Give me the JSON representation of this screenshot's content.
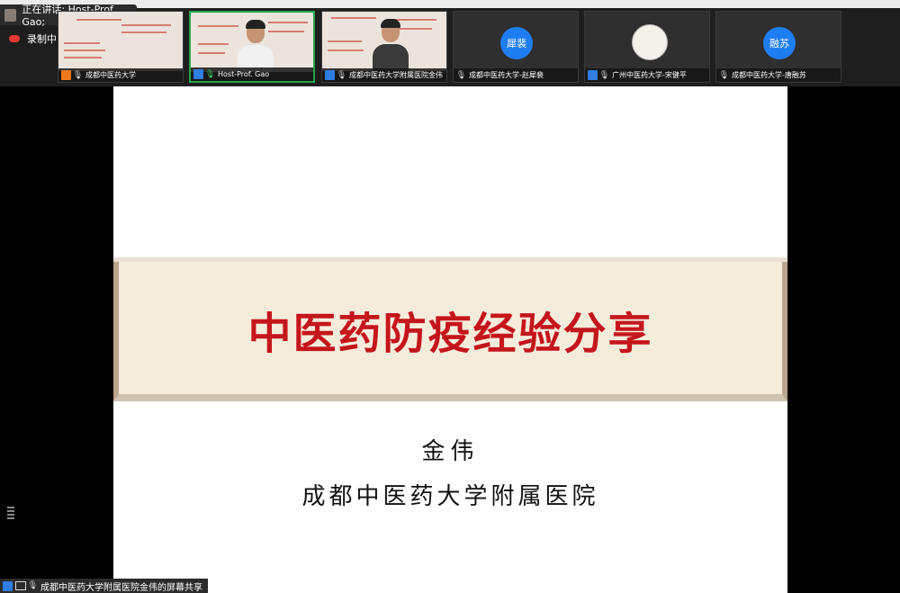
{
  "meeting": {
    "speaker_label": "正在讲话: Host-Prof. Gao;",
    "recording_label": "录制中"
  },
  "tiles": [
    {
      "name": "成都中医药大学",
      "type": "slide",
      "icon": "user-orange",
      "mic": "mic"
    },
    {
      "name": "Host-Prof. Gao",
      "type": "video",
      "icon": "user-blue",
      "mic": "mic-active",
      "active": true
    },
    {
      "name": "成都中医药大学附属医院金伟",
      "type": "slide-video",
      "icon": "user-blue",
      "mic": "mic"
    },
    {
      "name": "成都中医药大学-赵犀裴",
      "avatar": "犀裴",
      "type": "avatar",
      "icon": "none",
      "mic": "mic-muted"
    },
    {
      "name": "广州中医药大学-宋健平",
      "type": "photo",
      "icon": "user-blue",
      "mic": "mic-muted"
    },
    {
      "name": "成都中医药大学-唐融苏",
      "avatar": "融苏",
      "type": "avatar",
      "icon": "none",
      "mic": "mic-muted"
    }
  ],
  "slide": {
    "title": "中医药防疫经验分享",
    "presenter": "金伟",
    "organization": "成都中医药大学附属医院"
  },
  "share_status": "成都中医药大学附属医院金伟的屏幕共享",
  "colors": {
    "title_red": "#c4161c",
    "band": "#f6ecdc",
    "active_border": "#22a64a",
    "avatar_blue": "#1f7df2"
  }
}
